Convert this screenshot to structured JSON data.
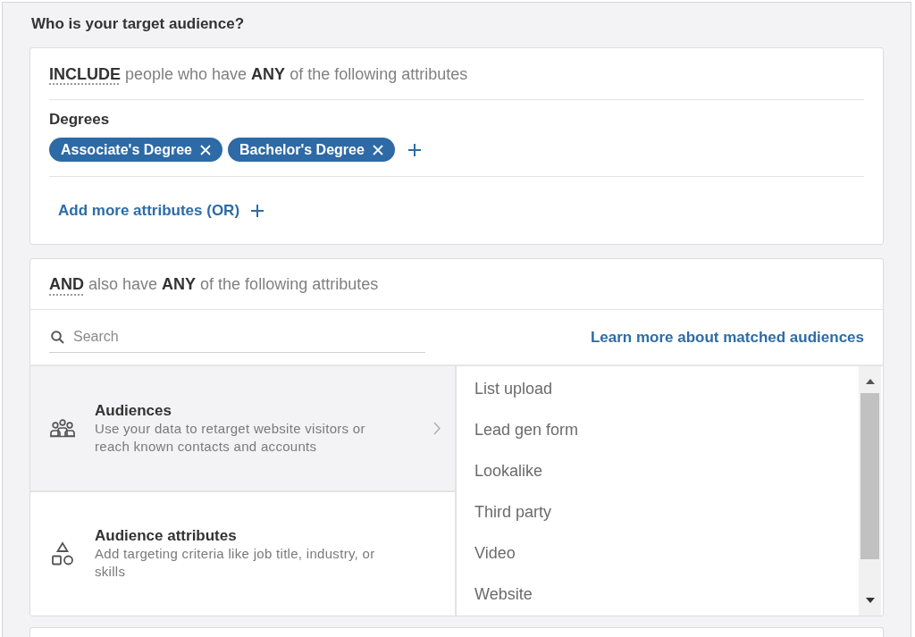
{
  "heading": "Who is your target audience?",
  "include_section": {
    "rule": "**INCLUDE** people who have **ANY** of the following attributes",
    "groups": [
      {
        "label": "Degrees",
        "tags": [
          "Associate's Degree",
          "Bachelor's Degree"
        ]
      }
    ],
    "add_more": "Add more attributes (OR)"
  },
  "and_section": {
    "rule": "**AND** also have **ANY** of the following attributes",
    "search": {
      "placeholder": "Search"
    },
    "link": "Learn more about matched audiences",
    "categories": [
      {
        "title": "Audiences",
        "description": "Use your data to retarget website visitors or reach known contacts and accounts",
        "selected": true
      },
      {
        "title": "Audience attributes",
        "description": "Add targeting criteria like job title, industry, or skills",
        "selected": false
      }
    ],
    "options": [
      "List upload",
      "Lead gen form",
      "Lookalike",
      "Third party",
      "Video",
      "Website"
    ]
  }
}
